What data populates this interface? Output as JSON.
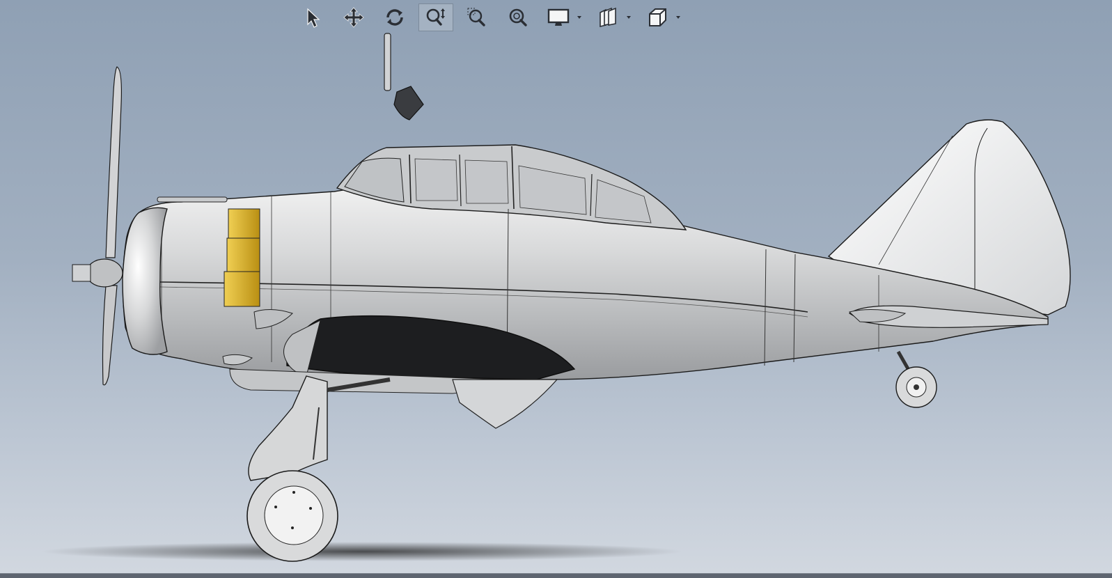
{
  "app": {
    "view": "graphics-area"
  },
  "toolbar": {
    "items": [
      {
        "id": "select",
        "icon": "arrow-pointer-icon",
        "active": false
      },
      {
        "id": "pan",
        "icon": "move-arrows-icon",
        "active": false
      },
      {
        "id": "rotate",
        "icon": "rotate-view-icon",
        "active": false
      },
      {
        "id": "zoom-to-fit",
        "icon": "zoom-to-fit-icon",
        "active": true
      },
      {
        "id": "zoom-to-area",
        "icon": "zoom-to-area-icon",
        "active": false
      },
      {
        "id": "zoom-in-out",
        "icon": "zoom-in-out-icon",
        "active": false
      },
      {
        "id": "display-style",
        "icon": "monitor-icon",
        "active": false,
        "dropdown": true
      },
      {
        "id": "view-settings",
        "icon": "layers-icon",
        "active": false,
        "dropdown": true
      },
      {
        "id": "view-orientation",
        "icon": "cube-view-icon",
        "active": false,
        "dropdown": true
      }
    ]
  },
  "colors": {
    "background_top": "#8fa0b4",
    "background_bottom": "#d2d8e0",
    "airframe": "#d9dadb",
    "cowl_band": "#d9b22a",
    "dark_panel": "#1d1e20",
    "edge": "#1a1a1a"
  }
}
